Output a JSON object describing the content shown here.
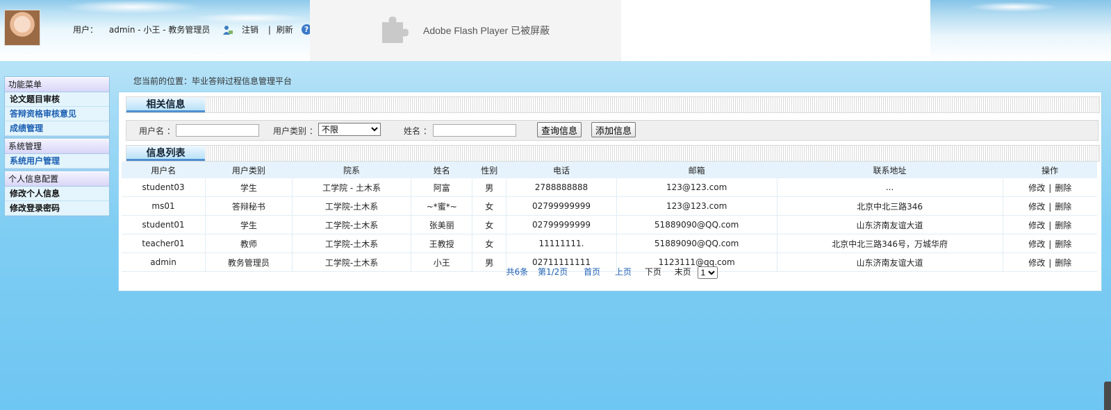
{
  "header": {
    "user_prefix": "用户：",
    "user_info": "admin - 小王 - 教务管理员",
    "logout": "注销",
    "separator": "|",
    "refresh": "刷新",
    "help_icon": "?",
    "flash_notice": "Adobe Flash Player 已被屏蔽"
  },
  "menu": {
    "groups": [
      {
        "title": "功能菜单",
        "items": [
          "论文题目审核",
          "答辩资格审核意见",
          "成绩管理"
        ]
      },
      {
        "title": "系统管理",
        "items": [
          "系统用户管理"
        ]
      },
      {
        "title": "个人信息配置",
        "items": [
          "修改个人信息",
          "修改登录密码"
        ]
      }
    ]
  },
  "breadcrumb": "您当前的位置：毕业答辩过程信息管理平台",
  "related_section": {
    "title": "相关信息"
  },
  "search": {
    "username_label": "用户名 ：",
    "username_value": "",
    "category_label": "用户类别 ：",
    "category_selected": "不限",
    "name_label": "姓名 ：",
    "name_value": "",
    "query_button": "查询信息",
    "add_button": "添加信息"
  },
  "list_section": {
    "title": "信息列表"
  },
  "table": {
    "headers": [
      "用户名",
      "用户类别",
      "院系",
      "姓名",
      "性别",
      "电话",
      "邮箱",
      "联系地址",
      "操作"
    ],
    "rows": [
      [
        "student03",
        "学生",
        "工学院 - 土木系",
        "阿富",
        "男",
        "2788888888",
        "123@123.com",
        "..."
      ],
      [
        "ms01",
        "答辩秘书",
        "工学院-土木系",
        "~*蜜*~",
        "女",
        "02799999999",
        "123@123.com",
        "北京中北三路346"
      ],
      [
        "student01",
        "学生",
        "工学院-土木系",
        "张美丽",
        "女",
        "02799999999",
        "51889090@QQ.com",
        "山东济南友谊大道"
      ],
      [
        "teacher01",
        "教师",
        "工学院-土木系",
        "王教授",
        "女",
        "11111111.",
        "51889090@QQ.com",
        "北京中北三路346号，万城华府"
      ],
      [
        "admin",
        "教务管理员",
        "工学院-土木系",
        "小王",
        "男",
        "02711111111",
        "1123111@qq.com",
        "山东济南友谊大道"
      ]
    ],
    "edit_label": "修改",
    "delete_label": "删除",
    "op_sep": "|"
  },
  "pager": {
    "total": "共6条",
    "page_info": "第1/2页",
    "first": "首页",
    "prev": "上页",
    "next": "下页",
    "last": "末页",
    "page_select": "1"
  },
  "colors": {
    "link_blue": "#1c5fb2",
    "tab_underline": "#4f8fd0",
    "background_sky": "#6ec6f2"
  }
}
